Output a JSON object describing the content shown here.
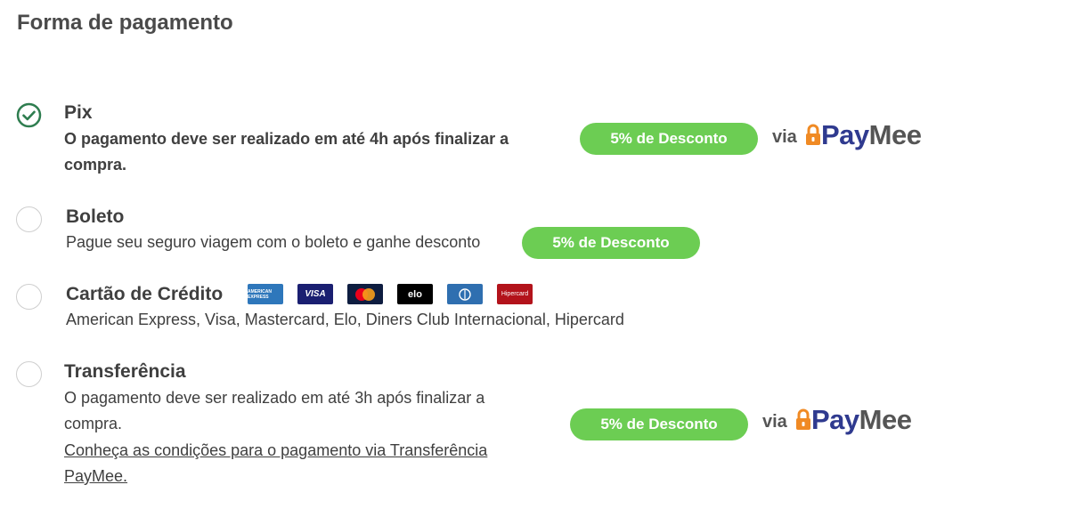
{
  "page": {
    "title": "Forma de pagamento"
  },
  "options": {
    "pix": {
      "title": "Pix",
      "description": "O pagamento deve ser realizado em até 4h após finalizar a compra.",
      "badge": "5% de Desconto",
      "via": "via",
      "provider_pay": "Pay",
      "provider_mee": "Mee",
      "selected": true
    },
    "boleto": {
      "title": "Boleto",
      "description": "Pague seu seguro viagem com o boleto e ganhe desconto",
      "badge": "5% de Desconto",
      "selected": false
    },
    "cartao": {
      "title": "Cartão de Crédito",
      "description": "American Express, Visa, Mastercard, Elo, Diners Club Internacional, Hipercard",
      "card_icons": [
        "amex-icon",
        "visa-icon",
        "mastercard-icon",
        "elo-icon",
        "diners-icon",
        "hipercard-icon"
      ],
      "card_labels": {
        "amex": "AMERICAN EXPRESS",
        "visa": "VISA",
        "elo": "elo",
        "hiper": "Hipercard"
      },
      "selected": false
    },
    "transferencia": {
      "title": "Transferência",
      "description": "O pagamento deve ser realizado em até 3h após finalizar a compra.",
      "link": "Conheça as condições para o pagamento via Transferência PayMee.",
      "badge": "5% de Desconto",
      "via": "via",
      "provider_pay": "Pay",
      "provider_mee": "Mee",
      "selected": false
    }
  },
  "colors": {
    "accent_green": "#6ccd53",
    "check_green": "#2e7d4f",
    "paymee_blue": "#2f3a8f",
    "paymee_orange": "#f08a24"
  }
}
